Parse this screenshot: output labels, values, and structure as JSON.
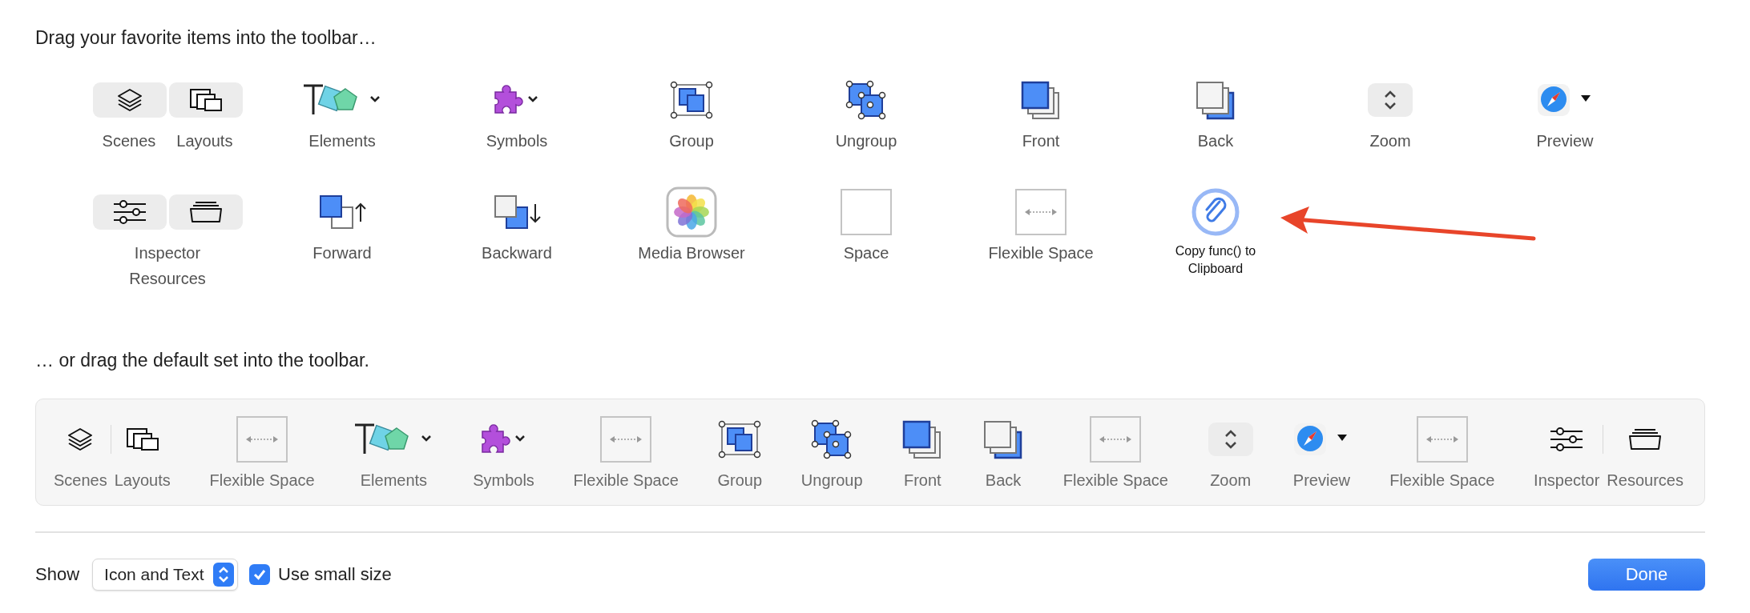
{
  "favorites": {
    "heading": "Drag your favorite items into the toolbar…",
    "rows": [
      [
        {
          "kind": "pair",
          "parts": [
            {
              "kind": "layers",
              "label": "Scenes"
            },
            {
              "kind": "layouts",
              "label": "Layouts"
            }
          ]
        },
        {
          "kind": "elements",
          "label": "Elements"
        },
        {
          "kind": "symbols",
          "label": "Symbols"
        },
        {
          "kind": "group",
          "label": "Group"
        },
        {
          "kind": "ungroup",
          "label": "Ungroup"
        },
        {
          "kind": "front",
          "label": "Front"
        },
        {
          "kind": "back",
          "label": "Back"
        },
        {
          "kind": "zoom",
          "label": "Zoom"
        },
        {
          "kind": "preview",
          "label": "Preview"
        }
      ],
      [
        {
          "kind": "pair_stacked",
          "parts": [
            {
              "kind": "sliders",
              "label": "Inspector"
            },
            {
              "kind": "tray",
              "label": "Resources"
            }
          ]
        },
        {
          "kind": "forward",
          "label": "Forward"
        },
        {
          "kind": "backward",
          "label": "Backward"
        },
        {
          "kind": "photos",
          "label": "Media Browser"
        },
        {
          "kind": "space",
          "label": "Space"
        },
        {
          "kind": "flexible_space",
          "label": "Flexible Space"
        },
        {
          "kind": "clipboard",
          "label": "Copy func() to Clipboard"
        }
      ]
    ]
  },
  "default_set": {
    "heading": "… or drag the default set into the toolbar.",
    "items": [
      {
        "kind": "pair",
        "parts": [
          {
            "kind": "layers",
            "label": "Scenes"
          },
          {
            "kind": "layouts",
            "label": "Layouts"
          }
        ]
      },
      {
        "kind": "flexible_space",
        "label": "Flexible Space"
      },
      {
        "kind": "elements",
        "label": "Elements"
      },
      {
        "kind": "symbols",
        "label": "Symbols"
      },
      {
        "kind": "flexible_space",
        "label": "Flexible Space"
      },
      {
        "kind": "group",
        "label": "Group"
      },
      {
        "kind": "ungroup",
        "label": "Ungroup"
      },
      {
        "kind": "front",
        "label": "Front"
      },
      {
        "kind": "back",
        "label": "Back"
      },
      {
        "kind": "flexible_space",
        "label": "Flexible Space"
      },
      {
        "kind": "zoom",
        "label": "Zoom"
      },
      {
        "kind": "preview",
        "label": "Preview"
      },
      {
        "kind": "flexible_space",
        "label": "Flexible Space"
      },
      {
        "kind": "pair",
        "parts": [
          {
            "kind": "sliders",
            "label": "Inspector"
          },
          {
            "kind": "tray",
            "label": "Resources"
          }
        ]
      }
    ]
  },
  "footer": {
    "show_label": "Show",
    "show_value": "Icon and Text",
    "small_size": {
      "label": "Use small size",
      "checked": true
    },
    "done": "Done"
  }
}
